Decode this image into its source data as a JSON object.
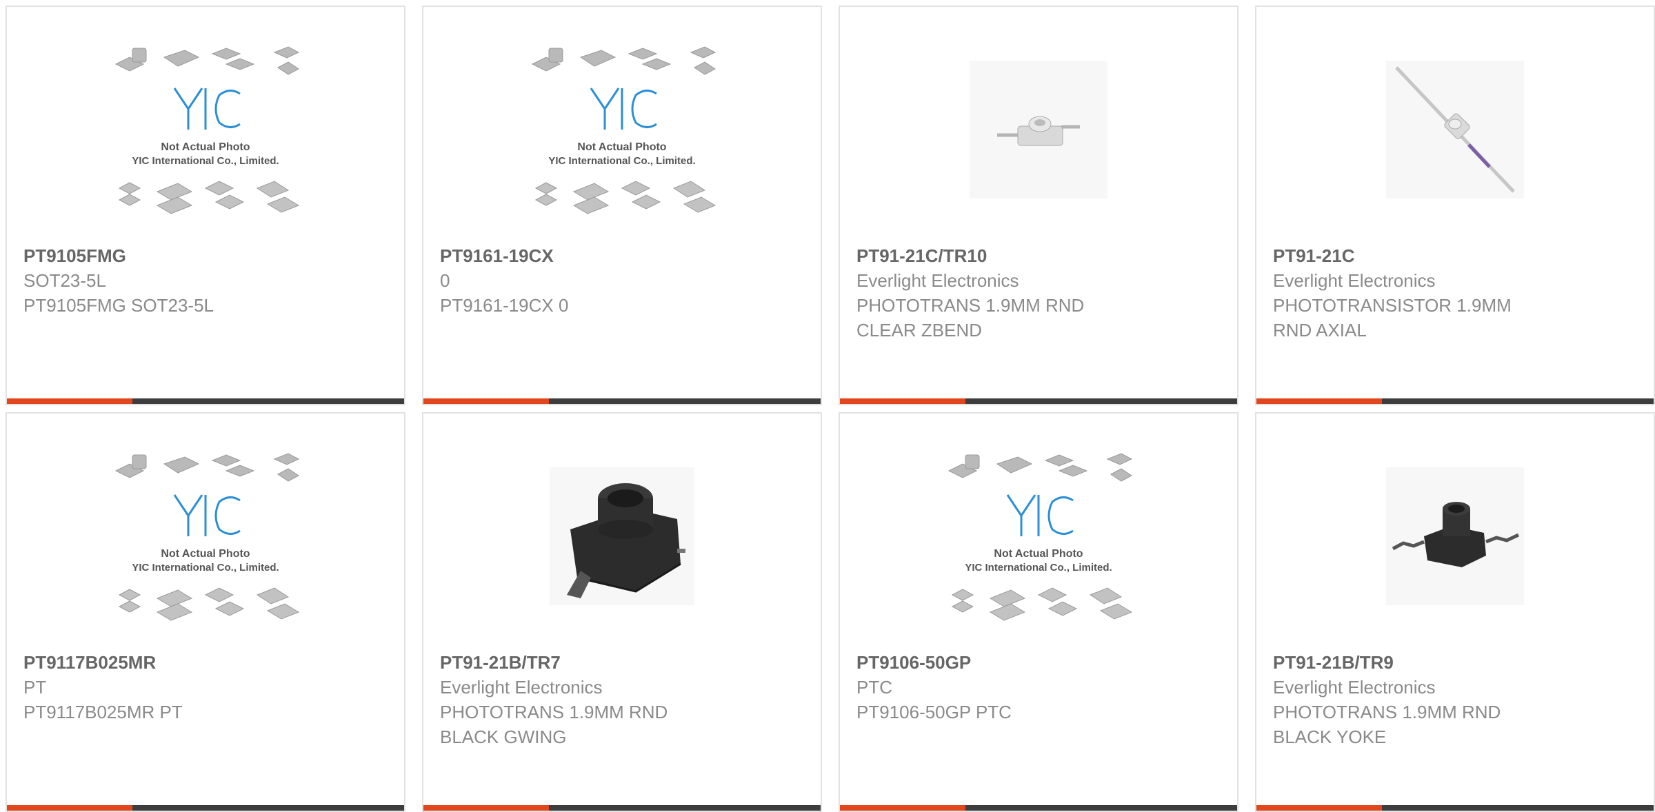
{
  "products": [
    {
      "part_number": "PT9105FMG",
      "manufacturer": "SOT23-5L",
      "desc_line1": "PT9105FMG SOT23-5L",
      "desc_line2": "",
      "image": "placeholder",
      "placeholder_line1": "Not Actual Photo",
      "placeholder_line2": "YIC International Co., Limited."
    },
    {
      "part_number": "PT9161-19CX",
      "manufacturer": "0",
      "desc_line1": "PT9161-19CX 0",
      "desc_line2": "",
      "image": "placeholder",
      "placeholder_line1": "Not Actual Photo",
      "placeholder_line2": "YIC International Co., Limited."
    },
    {
      "part_number": "PT91-21C/TR10",
      "manufacturer": "Everlight Electronics",
      "desc_line1": "PHOTOTRANS 1.9MM RND",
      "desc_line2": "CLEAR ZBEND",
      "image": "clear-zbend"
    },
    {
      "part_number": "PT91-21C",
      "manufacturer": "Everlight Electronics",
      "desc_line1": "PHOTOTRANSISTOR 1.9MM",
      "desc_line2": "RND AXIAL",
      "image": "axial"
    },
    {
      "part_number": "PT9117B025MR",
      "manufacturer": "PT",
      "desc_line1": "PT9117B025MR PT",
      "desc_line2": "",
      "image": "placeholder",
      "placeholder_line1": "Not Actual Photo",
      "placeholder_line2": "YIC International Co., Limited."
    },
    {
      "part_number": "PT91-21B/TR7",
      "manufacturer": "Everlight Electronics",
      "desc_line1": "PHOTOTRANS 1.9MM RND",
      "desc_line2": "BLACK GWING",
      "image": "black-gwing"
    },
    {
      "part_number": "PT9106-50GP",
      "manufacturer": "PTC",
      "desc_line1": "PT9106-50GP PTC",
      "desc_line2": "",
      "image": "placeholder",
      "placeholder_line1": "Not Actual Photo",
      "placeholder_line2": "YIC International Co., Limited."
    },
    {
      "part_number": "PT91-21B/TR9",
      "manufacturer": "Everlight Electronics",
      "desc_line1": "PHOTOTRANS 1.9MM RND",
      "desc_line2": "BLACK YOKE",
      "image": "black-yoke"
    }
  ],
  "colors": {
    "accent": "#e2461d",
    "bar": "#3d3d3d",
    "border": "#e2e2e2",
    "logo": "#2a8fd6"
  }
}
